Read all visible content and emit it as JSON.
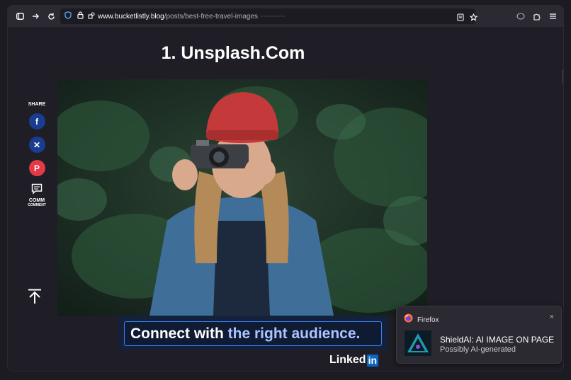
{
  "browser": {
    "url_domain": "www.bucketlistly.blog",
    "url_path": "/posts/best-free-travel-images",
    "url_extra": "◦◦◦◦◦◦◦◦◦◦",
    "icons": [
      "sidebar-icon",
      "forward-icon",
      "reload-icon",
      "shield-icon",
      "lock-icon",
      "permissions-icon",
      "reader-view-icon",
      "bookmark-star-icon",
      "account-icon",
      "extensions-icon",
      "menu-icon"
    ]
  },
  "page": {
    "title": "1. Unsplash.Com"
  },
  "share": {
    "label": "SHARE",
    "facebook": "f",
    "x": "✕",
    "pinterest": "P",
    "comment_label": "COMM",
    "comment_sub": "COMMENT"
  },
  "ad": {
    "text_part1": "Connect with ",
    "text_part2": "the right audience.",
    "brand_word": "Linked",
    "brand_box": "in"
  },
  "notification": {
    "app": "Firefox",
    "close": "×",
    "title": "ShieldAI: AI IMAGE ON PAGE",
    "subtitle": "Possibly AI-generated"
  },
  "colors": {
    "facebook": "#1a3d8f",
    "x": "#1a3d8f",
    "pinterest": "#e53945",
    "linkedin": "#0a66c2",
    "accent": "#3b82f6"
  }
}
